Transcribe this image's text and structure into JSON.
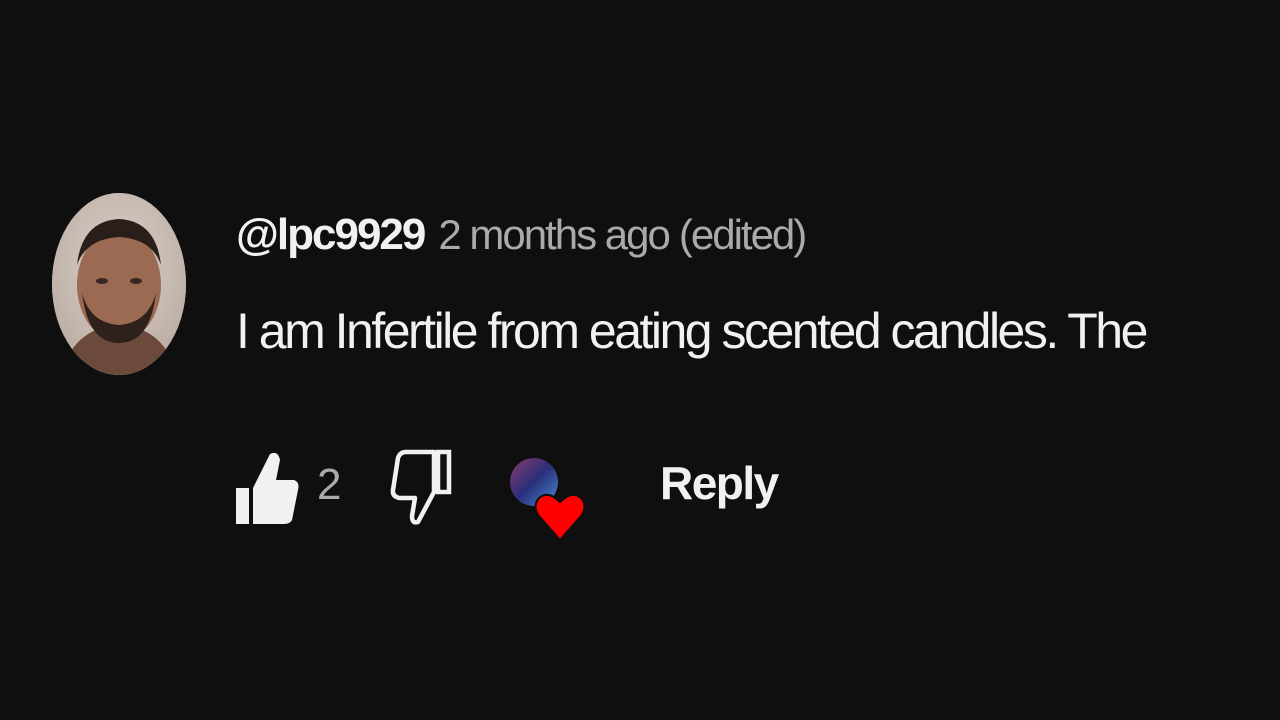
{
  "comment": {
    "author": "@lpc9929",
    "posted": "2 months ago",
    "edited_label": "(edited)",
    "text": "I am Infertile from eating scented candles. The",
    "like_count": "2",
    "reply_label": "Reply"
  },
  "icons": {
    "like": "thumbs-up-icon",
    "dislike": "thumbs-down-icon",
    "creator_heart": "heart-icon"
  },
  "colors": {
    "background": "#0f0f0f",
    "primary_text": "#f1f1f1",
    "secondary_text": "#aaaaaa",
    "heart": "#ff0000"
  }
}
